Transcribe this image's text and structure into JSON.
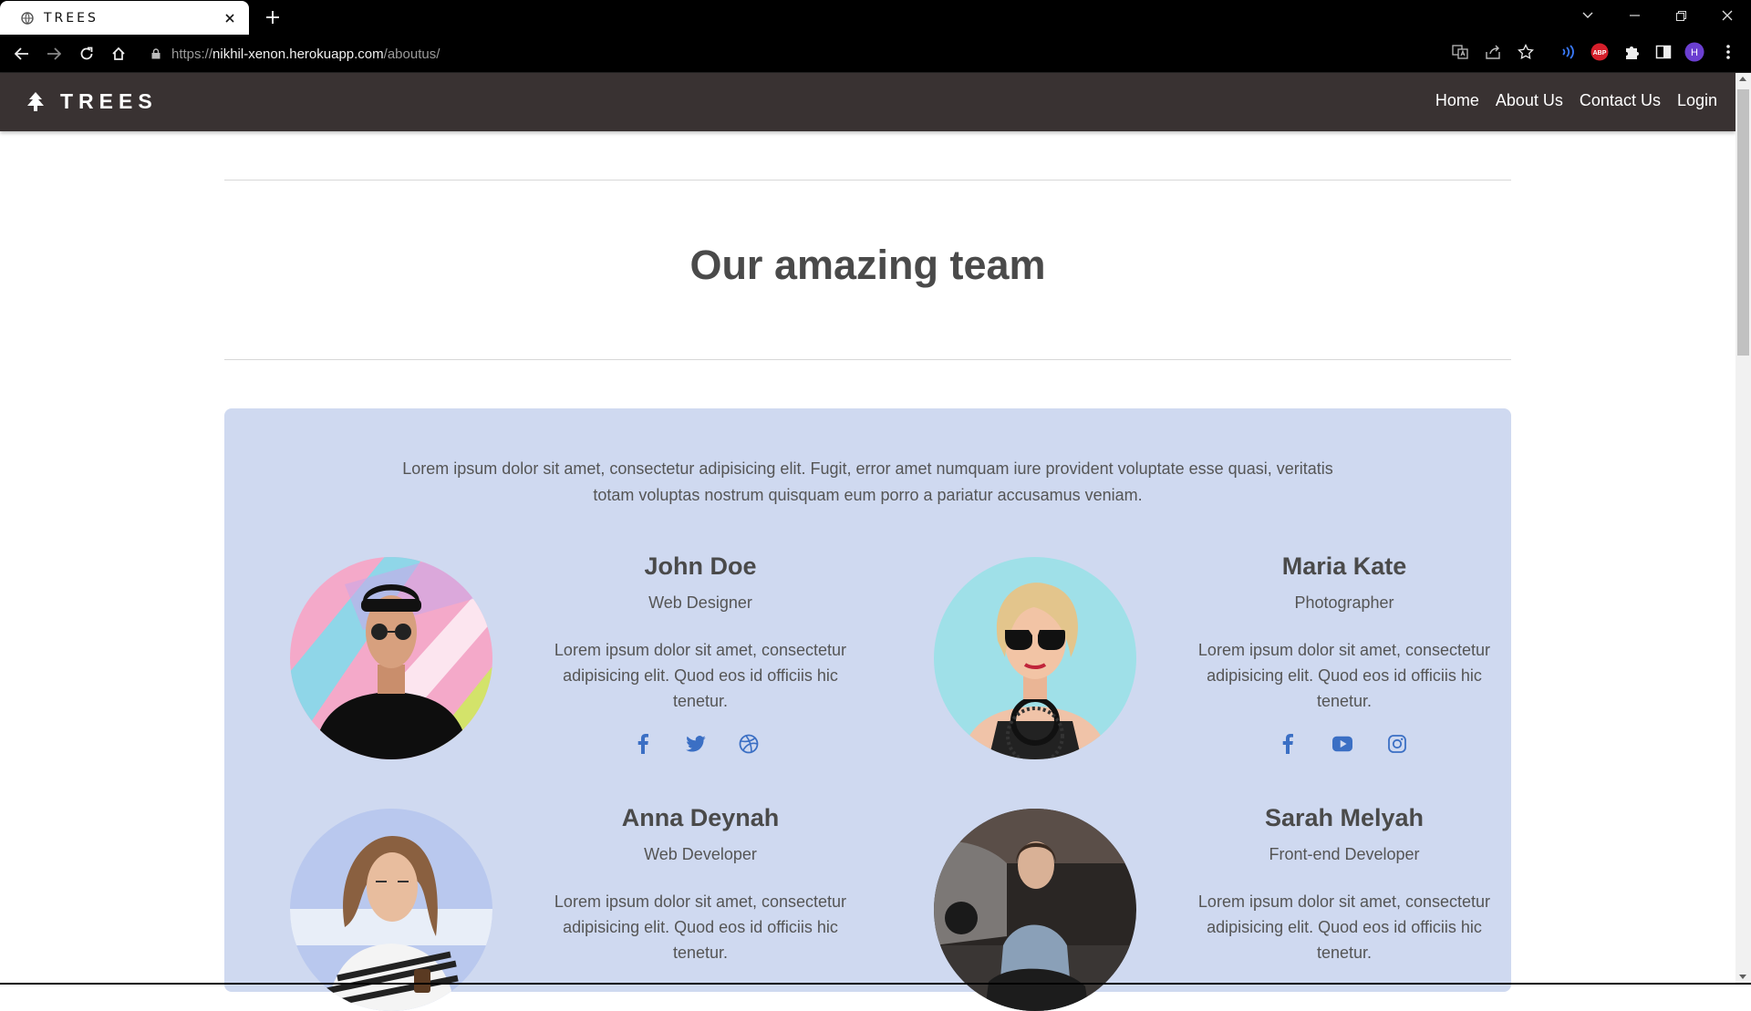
{
  "browser": {
    "tab_title": "TREES",
    "url": {
      "protocol": "https://",
      "host": "nikhil-xenon.herokuapp.com",
      "path": "/aboutus/"
    },
    "profile_initial": "H",
    "abp_label": "ABP"
  },
  "site": {
    "brand": "TREES",
    "nav": [
      "Home",
      "About Us",
      "Contact Us",
      "Login"
    ]
  },
  "page": {
    "heading": "Our amazing team",
    "intro": "Lorem ipsum dolor sit amet, consectetur adipisicing elit. Fugit, error amet numquam iure provident voluptate esse quasi, veritatis totam voluptas nostrum quisquam eum porro a pariatur accusamus veniam."
  },
  "team": [
    {
      "name": "John Doe",
      "role": "Web Designer",
      "bio": "Lorem ipsum dolor sit amet, consectetur adipisicing elit. Quod eos id officiis hic tenetur.",
      "socials": [
        "facebook-icon",
        "twitter-icon",
        "dribbble-icon"
      ]
    },
    {
      "name": "Maria Kate",
      "role": "Photographer",
      "bio": "Lorem ipsum dolor sit amet, consectetur adipisicing elit. Quod eos id officiis hic tenetur.",
      "socials": [
        "facebook-icon",
        "youtube-icon",
        "instagram-icon"
      ]
    },
    {
      "name": "Anna Deynah",
      "role": "Web Developer",
      "bio": "Lorem ipsum dolor sit amet, consectetur adipisicing elit. Quod eos id officiis hic tenetur.",
      "socials": []
    },
    {
      "name": "Sarah Melyah",
      "role": "Front-end Developer",
      "bio": "Lorem ipsum dolor sit amet, consectetur adipisicing elit. Quod eos id officiis hic tenetur.",
      "socials": []
    }
  ],
  "colors": {
    "navbar_bg": "#393232",
    "team_card_bg": "#cfd9f0",
    "social_icon": "#3b6fc4",
    "heading": "#4a4a4a"
  }
}
